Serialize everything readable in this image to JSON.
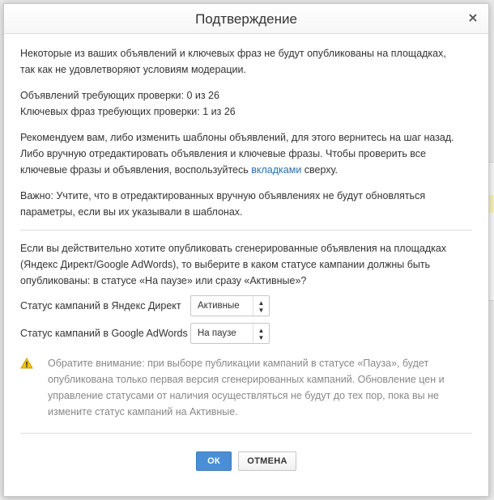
{
  "dialog": {
    "title": "Подтверждение",
    "close_glyph": "×",
    "intro": [
      "Некоторые из ваших объявлений и ключевых фраз  не будут опубликованы на площадках,",
      "так как не удовлетворяют условиям модерации."
    ],
    "counts": {
      "ads": "Объявлений требующих проверки: 0 из 26",
      "phrases": "Ключевых фраз требующих проверки: 1 из 26"
    },
    "recommend": {
      "line1": "Рекомендуем вам, либо изменить шаблоны объявлений, для этого вернитесь на шаг назад.",
      "line2": "Либо вручную отредактировать объявления и ключевые фразы. Чтобы проверить все",
      "line3_before": "ключевые фразы и объявления, воспользуйтесь ",
      "line3_link": "вкладками",
      "line3_after": " сверху."
    },
    "important": [
      "Важно: Учтите, что в отредактированных вручную объявлениях не будут обновляться",
      "параметры, если вы их указывали в шаблонах."
    ],
    "publish": [
      "Если вы действительно хотите опубликовать сгенерированные объявления на площадках",
      "(Яндекс Директ/Google AdWords), то выберите в каком статусе кампании должны быть",
      "опубликованы: в статусе «На паузе» или сразу «Активные»?"
    ],
    "status": {
      "yandex_label": "Статус кампаний в Яндекс Директ",
      "yandex_value": "Активные",
      "google_label": "Статус кампаний в Google AdWords",
      "google_value": "На паузе"
    },
    "warning": [
      "Обратите внимание: при выборе публикации кампаний в статусе «Пауза», будет",
      "опубликована только первая версия сгенерированных кампаний. Обновление цен и",
      "управление статусами от наличия осуществляться не будут до тех пор, пока вы не",
      "измените статус кампаний на Активные."
    ],
    "buttons": {
      "ok": "ОК",
      "cancel": "ОТМЕНА"
    }
  },
  "colors": {
    "accent": "#4a8fd6",
    "link": "#2a6fb0",
    "warning_icon": "#f2c200",
    "muted_text": "#888888"
  },
  "icons": {
    "close": "close-icon",
    "warning": "warning-icon",
    "select_arrows": "updown-arrows-icon"
  }
}
